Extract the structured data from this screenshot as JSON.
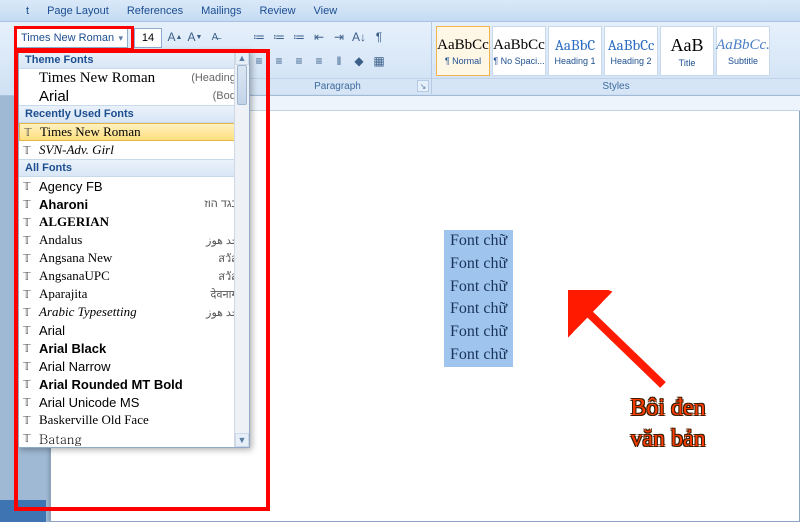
{
  "menu": {
    "items": [
      "t",
      "Page Layout",
      "References",
      "Mailings",
      "Review",
      "View"
    ]
  },
  "font_group": {
    "font_name": "Times New Roman",
    "font_size": "14",
    "grow_icon": "A▲",
    "shrink_icon": "A▼",
    "clear_icon": "Aₐ"
  },
  "para_buttons_top": [
    "≣",
    "≣",
    "≣",
    "≡",
    "⇤",
    "⇥",
    "A↓",
    "¶"
  ],
  "para_buttons_bottom": [
    "≡",
    "≡",
    "≡",
    "≡",
    "‖",
    "◆",
    "▦"
  ],
  "paragraph_label": "Paragraph",
  "styles_label": "Styles",
  "styles": [
    {
      "preview": "AaBbCc",
      "label": "¶ Normal"
    },
    {
      "preview": "AaBbCc",
      "label": "¶ No Spaci..."
    },
    {
      "preview": "AaBbC",
      "label": "Heading 1"
    },
    {
      "preview": "AaBbCc",
      "label": "Heading 2"
    },
    {
      "preview": "AaB",
      "label": "Title"
    },
    {
      "preview": "AaBbCc.",
      "label": "Subtitle"
    }
  ],
  "fontdrop": {
    "theme_header": "Theme Fonts",
    "theme": [
      {
        "name": "Times New Roman",
        "hint": "(Headings)"
      },
      {
        "name": "Arial",
        "hint": "(Body)"
      }
    ],
    "recent_header": "Recently Used Fonts",
    "recent": [
      {
        "name": "Times New Roman",
        "selected": true,
        "family": "'Times New Roman', serif"
      },
      {
        "name": "SVN-Adv. Girl",
        "family": "cursive",
        "italic": true
      }
    ],
    "all_header": "All Fonts",
    "all": [
      {
        "name": "Agency FB",
        "family": "'Agency FB', sans-serif",
        "sample": ""
      },
      {
        "name": "Aharoni",
        "family": "Arial, sans-serif",
        "bold": true,
        "sample": "אבגד הוז"
      },
      {
        "name": "ALGERIAN",
        "family": "'Algerian', serif",
        "bold": true,
        "sample": ""
      },
      {
        "name": "Andalus",
        "family": "'Times New Roman', serif",
        "sample": "أبجد هوز"
      },
      {
        "name": "Angsana New",
        "family": "'Angsana New', serif",
        "sample": "สวัสดี"
      },
      {
        "name": "AngsanaUPC",
        "family": "'AngsanaUPC', serif",
        "sample": "สวัสดี"
      },
      {
        "name": "Aparajita",
        "family": "serif",
        "sample": "देवनागरी"
      },
      {
        "name": "Arabic Typesetting",
        "family": "serif",
        "italic": true,
        "sample": "أبجد هوز"
      },
      {
        "name": "Arial",
        "family": "Arial, sans-serif",
        "sample": ""
      },
      {
        "name": "Arial Black",
        "family": "'Arial Black', sans-serif",
        "bold": true,
        "sample": ""
      },
      {
        "name": "Arial Narrow",
        "family": "'Arial Narrow', sans-serif",
        "sample": ""
      },
      {
        "name": "Arial Rounded MT Bold",
        "family": "Arial, sans-serif",
        "bold": true,
        "sample": ""
      },
      {
        "name": "Arial Unicode MS",
        "family": "Arial, sans-serif",
        "sample": ""
      },
      {
        "name": "Baskerville Old Face",
        "family": "Baskerville, 'Times New Roman', serif",
        "sample": ""
      },
      {
        "name": "Batang",
        "family": "Batang, serif",
        "sample": ""
      }
    ]
  },
  "doc_text": "Font chữ",
  "annotation": {
    "line1": "Bôi đen",
    "line2": "văn bản"
  }
}
